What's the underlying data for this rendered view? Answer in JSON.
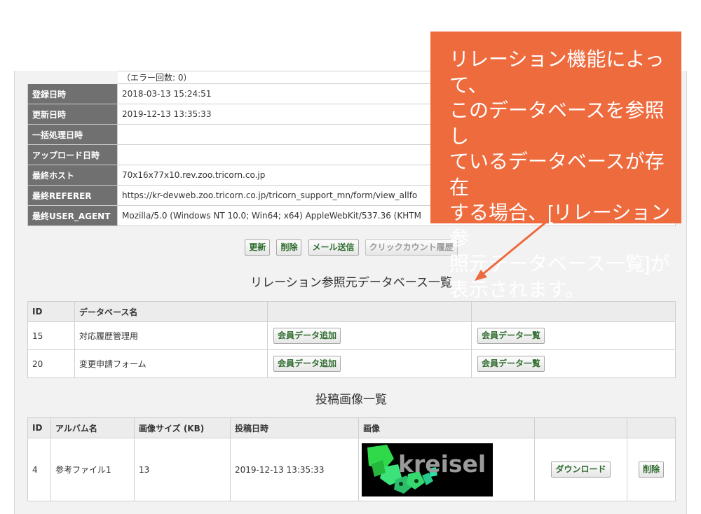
{
  "info_rows": [
    {
      "label": "",
      "value": "（エラー回数: 0）"
    },
    {
      "label": "登録日時",
      "value": "2018-03-13 15:24:51"
    },
    {
      "label": "更新日時",
      "value": "2019-12-13 13:35:33"
    },
    {
      "label": "一括処理日時",
      "value": ""
    },
    {
      "label": "アップロード日時",
      "value": ""
    },
    {
      "label": "最終ホスト",
      "value": "70x16x77x10.rev.zoo.tricorn.co.jp"
    },
    {
      "label": "最終REFERER",
      "value": "https://kr-devweb.zoo.tricorn.co.jp/tricorn_support_mn/form/view_allfo"
    },
    {
      "label": "最終USER_AGENT",
      "value": "Mozilla/5.0 (Windows NT 10.0; Win64; x64) AppleWebKit/537.36 (KHTM"
    }
  ],
  "actions": {
    "update": "更新",
    "delete": "削除",
    "send_mail": "メール送信",
    "click_count_history": "クリックカウント履歴"
  },
  "relation": {
    "title": "リレーション参照元データベース一覧",
    "headers": {
      "id": "ID",
      "name": "データベース名"
    },
    "rows": [
      {
        "id": "15",
        "name": "対応履歴管理用",
        "add_label": "会員データ追加",
        "list_label": "会員データ一覧"
      },
      {
        "id": "20",
        "name": "変更申請フォーム",
        "add_label": "会員データ追加",
        "list_label": "会員データ一覧"
      }
    ]
  },
  "images": {
    "title": "投稿画像一覧",
    "headers": {
      "id": "ID",
      "album": "アルバム名",
      "size": "画像サイズ (KB)",
      "date": "投稿日時",
      "image": "画像"
    },
    "rows": [
      {
        "id": "4",
        "album": "参考ファイル1",
        "size": "13",
        "date": "2019-12-13 13:35:33",
        "logo_text": "kreisel",
        "download_label": "ダウンロード",
        "delete_label": "削除"
      }
    ]
  },
  "callout": {
    "lines": [
      "リレーション機能によって、",
      "このデータベースを参照し",
      "ているデータベースが存在",
      "する場合、[リレーション参",
      "照元データベース一覧]が",
      "表示されます。"
    ]
  },
  "colors": {
    "callout_bg": "#ee6b3e",
    "label_bg": "#707070",
    "button_text": "#2e6b2e"
  }
}
